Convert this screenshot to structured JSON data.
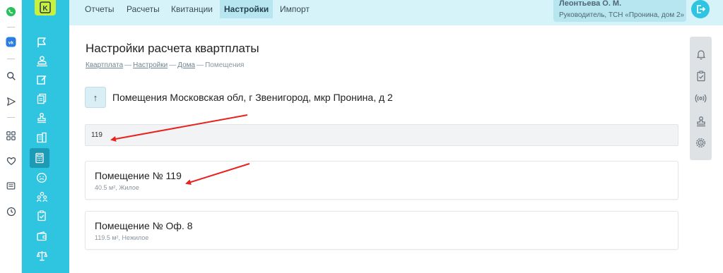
{
  "nav": {
    "tabs": [
      {
        "label": "Отчеты"
      },
      {
        "label": "Расчеты"
      },
      {
        "label": "Квитанции"
      },
      {
        "label": "Настройки"
      },
      {
        "label": "Импорт"
      }
    ],
    "active_tab": "Настройки"
  },
  "user": {
    "name": "Леонтьева О. М.",
    "role": "Руководитель, ТСН «Пронина, дом 2»"
  },
  "page": {
    "title": "Настройки расчета квартплаты",
    "breadcrumbs": [
      "Квартплата",
      "Настройки",
      "Дома",
      "Помещения"
    ],
    "address": "Помещения Московская обл, г Звенигород, мкр Пронина, д 2",
    "up_icon": "↑"
  },
  "search": {
    "value": "119"
  },
  "rooms": [
    {
      "name": "Помещение № 119",
      "info": "40.5 м², Жилое"
    },
    {
      "name": "Помещение № Оф. 8",
      "info": "119.5 м², Нежилое"
    }
  ],
  "logo": {
    "letter": "K"
  },
  "colors": {
    "sidebar": "#2fc4e0",
    "topnav": "#d7f3fa",
    "logo": "#c9ef3f",
    "annotation_arrow": "#e8231f"
  },
  "icons": {
    "appbar": [
      "whatsapp-icon",
      "vk-icon",
      "search-icon",
      "send-icon",
      "apps-icon",
      "heart-icon",
      "news-icon",
      "clock-icon"
    ],
    "sidebar": [
      "flag-icon",
      "users-icon",
      "edit-icon",
      "documents-icon",
      "stamp-icon",
      "building-icon",
      "calculator-icon",
      "smile-icon",
      "team-icon",
      "checklist-icon",
      "wallet-icon",
      "scales-icon"
    ],
    "right_panel": [
      "bell-icon",
      "checklist-icon",
      "broadcast-icon",
      "stamp-icon",
      "settings-icon"
    ]
  }
}
